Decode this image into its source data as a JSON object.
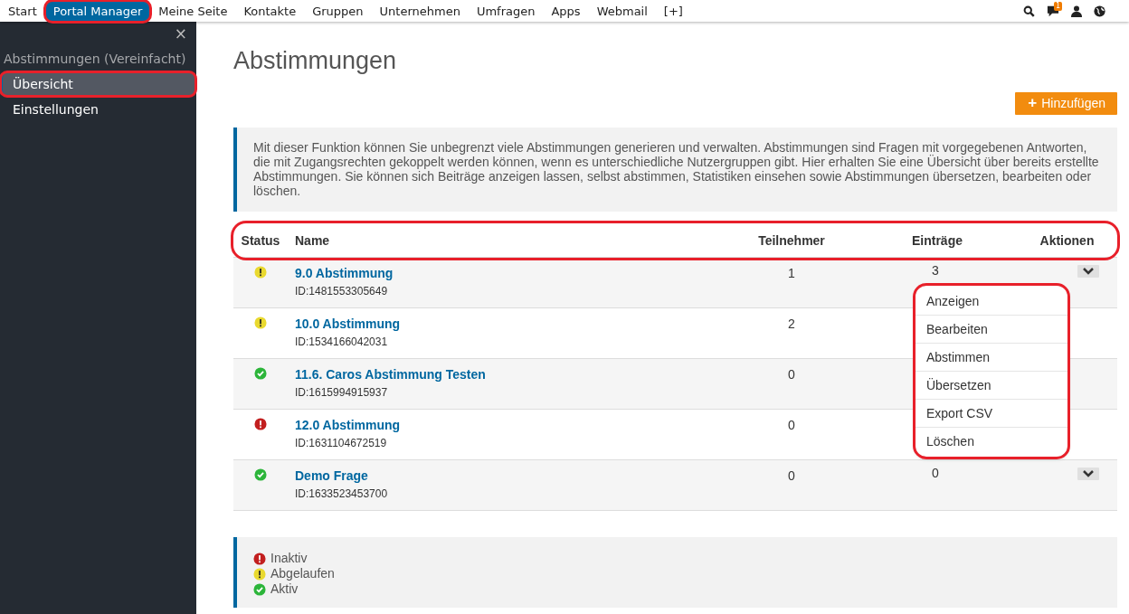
{
  "top_nav": {
    "items": [
      {
        "label": "Start",
        "selected": false,
        "highlighted": false
      },
      {
        "label": "Portal Manager",
        "selected": true,
        "highlighted": true
      },
      {
        "label": "Meine Seite",
        "selected": false,
        "highlighted": false
      },
      {
        "label": "Kontakte",
        "selected": false,
        "highlighted": false
      },
      {
        "label": "Gruppen",
        "selected": false,
        "highlighted": false
      },
      {
        "label": "Unternehmen",
        "selected": false,
        "highlighted": false
      },
      {
        "label": "Umfragen",
        "selected": false,
        "highlighted": false
      },
      {
        "label": "Apps",
        "selected": false,
        "highlighted": false
      },
      {
        "label": "Webmail",
        "selected": false,
        "highlighted": false
      },
      {
        "label": "[+]",
        "selected": false,
        "highlighted": false
      }
    ],
    "icons": [
      {
        "kind": "search"
      },
      {
        "kind": "chat",
        "badge": "1"
      },
      {
        "kind": "user"
      },
      {
        "kind": "globe"
      }
    ]
  },
  "sidebar": {
    "close": "×",
    "heading": "Abstimmungen (Vereinfacht)",
    "items": [
      {
        "label": "Übersicht",
        "selected": true,
        "highlighted": true
      },
      {
        "label": "Einstellungen",
        "selected": false,
        "highlighted": false
      }
    ]
  },
  "page": {
    "title": "Abstimmungen",
    "add_button": {
      "icon": "+",
      "label": "Hinzufügen"
    },
    "info": "Mit dieser Funktion können Sie unbegrenzt viele Abstimmungen generieren und verwalten. Abstimmungen sind Fragen mit vorgegebenen Antworten, die mit Zugangsrechten gekoppelt werden können, wenn es unterschiedliche Nutzergruppen gibt. Hier erhalten Sie eine Übersicht über bereits erstellte Abstimmungen. Sie können sich Beiträge anzeigen lassen, selbst abstimmen, Statistiken einsehen sowie Abstimmungen übersetzen, bearbeiten oder löschen."
  },
  "table": {
    "header_highlighted": true,
    "columns": [
      "Status",
      "Name",
      "Teilnehmer",
      "Einträge",
      "Aktionen"
    ],
    "rows": [
      {
        "kind": "expired",
        "name": "9.0 Abstimmung",
        "id": "ID:1481553305649",
        "participants": "1",
        "entries": "3",
        "actions_visible": true
      },
      {
        "kind": "expired",
        "name": "10.0 Abstimmung",
        "id": "ID:1534166042031",
        "participants": "2",
        "actions_visible": false
      },
      {
        "kind": "active",
        "name": "11.6. Caros Abstimmung Testen",
        "id": "ID:1615994915937",
        "participants": "0",
        "actions_visible": false
      },
      {
        "kind": "inactive",
        "name": "12.0 Abstimmung",
        "id": "ID:1631104672519",
        "participants": "0",
        "actions_visible": false
      },
      {
        "kind": "active",
        "name": "Demo Frage",
        "id": "ID:1633523453700",
        "participants": "0",
        "entries": "0",
        "actions_visible": true
      }
    ]
  },
  "actions_menu": {
    "highlighted": true,
    "items": [
      "Anzeigen",
      "Bearbeiten",
      "Abstimmen",
      "Übersetzen",
      "Export CSV",
      "Löschen"
    ]
  },
  "legend": [
    {
      "kind": "inactive",
      "label": "Inaktiv"
    },
    {
      "kind": "expired",
      "label": "Abgelaufen"
    },
    {
      "kind": "active",
      "label": "Aktiv"
    }
  ]
}
